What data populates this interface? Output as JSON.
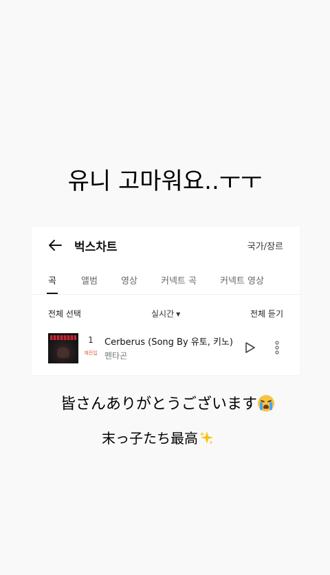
{
  "story": {
    "text1": "유니 고마워요..ㅜㅜ",
    "text2": "皆さんありがとうございます",
    "text2_emoji": "loudly-crying-face",
    "text3": "末っ子たち最高",
    "text3_emoji": "sparkles"
  },
  "chart": {
    "title": "벅스차트",
    "country_genre": "국가/장르",
    "tabs": [
      {
        "label": "곡",
        "active": true
      },
      {
        "label": "앨범",
        "active": false
      },
      {
        "label": "영상",
        "active": false
      },
      {
        "label": "커넥트 곡",
        "active": false
      },
      {
        "label": "커넥트 영상",
        "active": false
      }
    ],
    "select_all": "전체 선택",
    "sort": "실시간",
    "play_all": "전체 듣기",
    "tracks": [
      {
        "rank": "1",
        "rank_badge": "재진입",
        "title": "Cerberus (Song By 유토, 키노)",
        "artist": "펜타곤"
      }
    ]
  },
  "colors": {
    "background": "#f9f9f9",
    "card": "#ffffff",
    "badge": "#e0553a"
  }
}
